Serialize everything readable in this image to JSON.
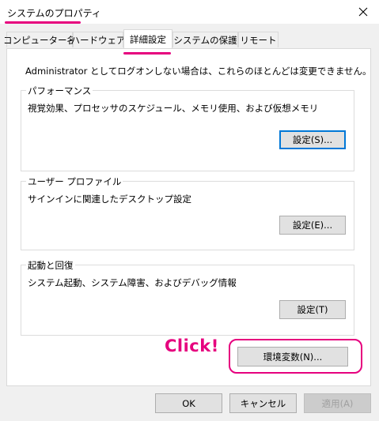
{
  "window": {
    "title": "システムのプロパティ",
    "close_icon": "close-icon",
    "highlight_color": "#e6007e"
  },
  "tabs": [
    {
      "label": "コンピューター名",
      "active": false
    },
    {
      "label": "ハードウェア",
      "active": false
    },
    {
      "label": "詳細設定",
      "active": true
    },
    {
      "label": "システムの保護",
      "active": false
    },
    {
      "label": "リモート",
      "active": false
    }
  ],
  "panel": {
    "intro": "Administrator としてログオンしない場合は、これらのほとんどは変更できません。",
    "performance": {
      "legend": "パフォーマンス",
      "description": "視覚効果、プロセッサのスケジュール、メモリ使用、および仮想メモリ",
      "button": "設定(S)..."
    },
    "profile": {
      "legend": "ユーザー プロファイル",
      "description": "サインインに関連したデスクトップ設定",
      "button": "設定(E)..."
    },
    "startup": {
      "legend": "起動と回復",
      "description": "システム起動、システム障害、およびデバッグ情報",
      "button": "設定(T)"
    },
    "env_button": "環境変数(N)..."
  },
  "annotation": {
    "click_label": "Click!"
  },
  "footer": {
    "ok": "OK",
    "cancel": "キャンセル",
    "apply": "適用(A)"
  }
}
